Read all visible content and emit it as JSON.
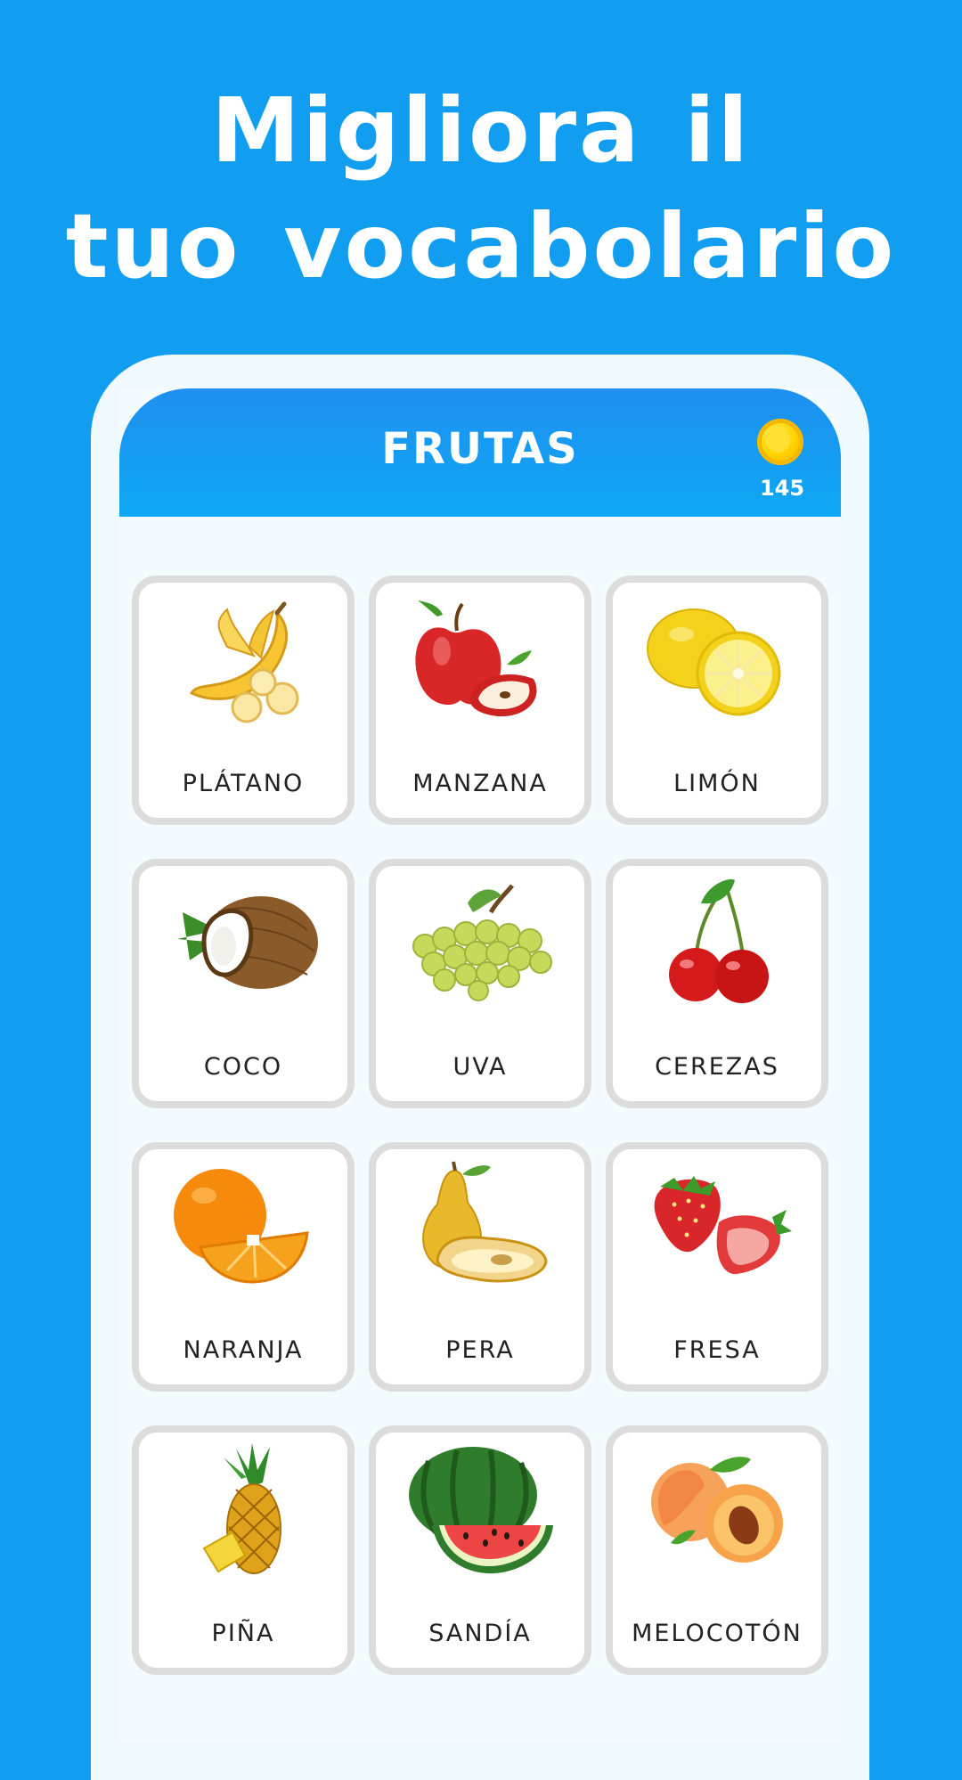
{
  "promo": {
    "line1": "Migliora il",
    "line2": "tuo vocabolario"
  },
  "header": {
    "title": "FRUTAS",
    "coin_icon": "coin-icon",
    "coins": "145"
  },
  "colors": {
    "background": "#119df0",
    "header": "#1f8ff0",
    "card_border": "#dcdcdc"
  },
  "cards": [
    {
      "label": "PLÁTANO",
      "icon": "banana-icon"
    },
    {
      "label": "MANZANA",
      "icon": "apple-icon"
    },
    {
      "label": "LIMÓN",
      "icon": "lemon-icon"
    },
    {
      "label": "COCO",
      "icon": "coconut-icon"
    },
    {
      "label": "UVA",
      "icon": "grapes-icon"
    },
    {
      "label": "CEREZAS",
      "icon": "cherries-icon"
    },
    {
      "label": "NARANJA",
      "icon": "orange-icon"
    },
    {
      "label": "PERA",
      "icon": "pear-icon"
    },
    {
      "label": "FRESA",
      "icon": "strawberry-icon"
    },
    {
      "label": "PIÑA",
      "icon": "pineapple-icon"
    },
    {
      "label": "SANDÍA",
      "icon": "watermelon-icon"
    },
    {
      "label": "MELOCOTÓN",
      "icon": "peach-icon"
    }
  ]
}
